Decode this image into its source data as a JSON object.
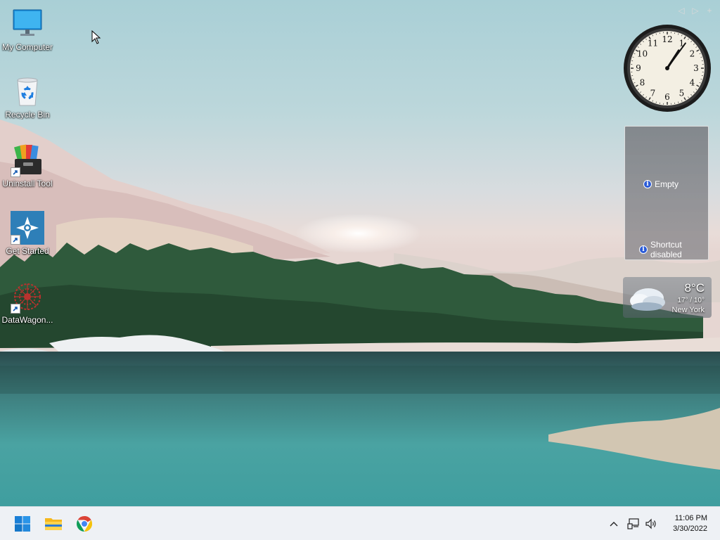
{
  "desktop": {
    "icons": [
      {
        "label": "My Computer",
        "icon": "monitor-icon"
      },
      {
        "label": "Recycle Bin",
        "icon": "recycle-bin-icon"
      },
      {
        "label": "Uninstall Tool",
        "icon": "uninstall-tool-icon"
      },
      {
        "label": "Get Started",
        "icon": "get-started-icon"
      },
      {
        "label": "DataWagon...",
        "icon": "datawagon-icon"
      }
    ]
  },
  "gadgets": {
    "controls": [
      "previous-icon",
      "next-icon",
      "add-icon"
    ],
    "clock": {
      "hour": 1,
      "minute": 6,
      "numerals": [
        "12",
        "1",
        "2",
        "3",
        "4",
        "5",
        "6",
        "7",
        "8",
        "9",
        "10",
        "11"
      ]
    },
    "slideshow": {
      "empty_label": "Empty",
      "shortcut_label_line1": "Shortcut",
      "shortcut_label_line2": "disabled"
    },
    "weather": {
      "temp": "8°C",
      "range": "17° / 10°",
      "city": "New York",
      "icon": "cloud-icon"
    }
  },
  "taskbar": {
    "pinned": [
      "start-icon",
      "file-explorer-icon",
      "chrome-icon"
    ],
    "tray": {
      "icons": [
        "chevron-up-icon",
        "network-icon",
        "volume-icon"
      ]
    },
    "time": "11:06 PM",
    "date": "3/30/2022"
  }
}
